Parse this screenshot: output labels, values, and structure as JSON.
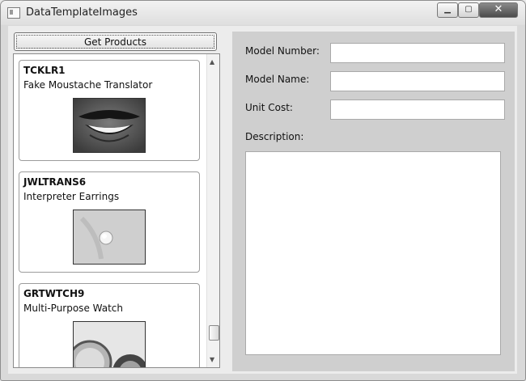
{
  "window": {
    "title": "DataTemplateImages",
    "minimize": "▁",
    "maximize": "▢",
    "close": "✕"
  },
  "toolbar": {
    "get_products_label": "Get Products"
  },
  "products": [
    {
      "code": "TCKLR1",
      "name": "Fake Moustache Translator",
      "image": "smiling-mouth-photo"
    },
    {
      "code": "JWLTRANS6",
      "name": "Interpreter Earrings",
      "image": "earlobe-with-pearl-earring-photo"
    },
    {
      "code": "GRTWTCH9",
      "name": "Multi-Purpose Watch",
      "image": "watch-photo"
    }
  ],
  "list_scroll": {
    "up": "▲",
    "down": "▼"
  },
  "details": {
    "model_number_label": "Model Number:",
    "model_number_value": "",
    "model_name_label": "Model Name:",
    "model_name_value": "",
    "unit_cost_label": "Unit Cost:",
    "unit_cost_value": "",
    "description_label": "Description:",
    "description_value": "",
    "scroll_up": "▲",
    "scroll_down": "▼"
  }
}
